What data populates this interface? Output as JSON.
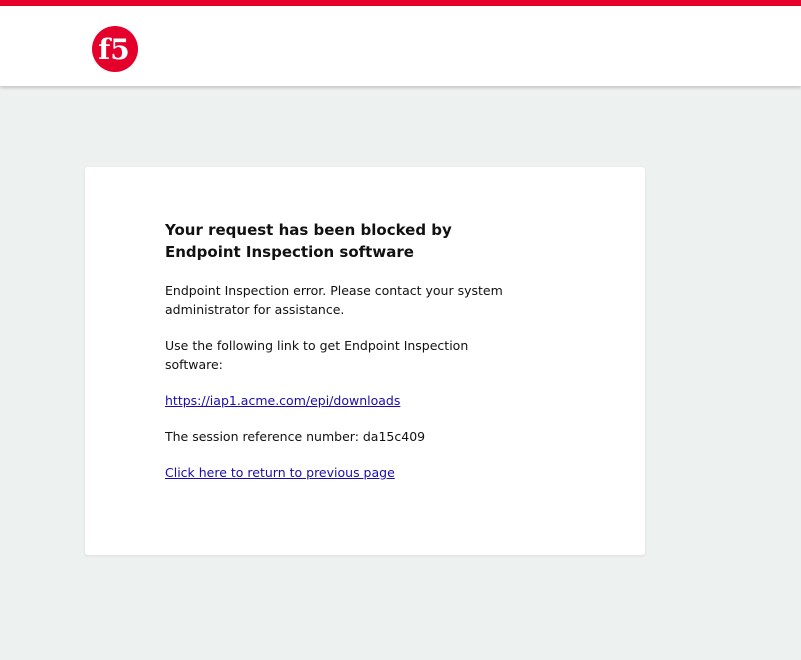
{
  "brand": {
    "logo_text": "f5",
    "accent_color": "#e4002b"
  },
  "message": {
    "title": "Your request has been blocked by Endpoint Inspection software",
    "error_text": "Endpoint Inspection error. Please contact your system administrator for assistance.",
    "link_intro": "Use the following link to get Endpoint Inspection software:",
    "download_link": "https://iap1.acme.com/epi/downloads",
    "session_text": "The session reference number: da15c409",
    "return_link": "Click here to return to previous page"
  }
}
